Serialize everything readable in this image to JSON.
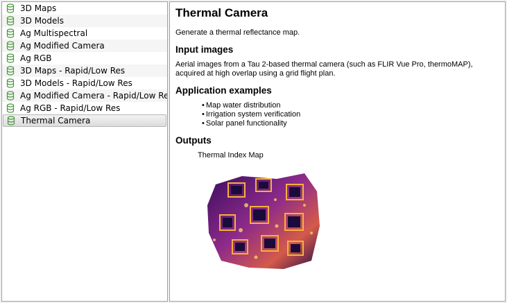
{
  "templates": [
    {
      "label": "3D Maps"
    },
    {
      "label": "3D Models"
    },
    {
      "label": "Ag Multispectral"
    },
    {
      "label": "Ag Modified Camera"
    },
    {
      "label": "Ag RGB"
    },
    {
      "label": "3D Maps - Rapid/Low Res"
    },
    {
      "label": "3D Models - Rapid/Low Res"
    },
    {
      "label": "Ag Modified Camera - Rapid/Low Res"
    },
    {
      "label": "Ag RGB - Rapid/Low Res"
    },
    {
      "label": "Thermal Camera"
    }
  ],
  "selected_index": 9,
  "detail": {
    "title": "Thermal Camera",
    "description": "Generate a thermal reflectance map.",
    "input_heading": "Input images",
    "input_text": "Aerial images from a Tau 2-based thermal camera (such as FLIR Vue Pro, thermoMAP), acquired at high overlap using a grid flight plan.",
    "examples_heading": "Application examples",
    "examples": [
      "Map water distribution",
      "Irrigation system verification",
      "Solar panel functionality"
    ],
    "outputs_heading": "Outputs",
    "output_caption": "Thermal Index Map"
  },
  "colors": {
    "icon_green": "#4a9a3c",
    "thermal_dark": "#1a0b3a",
    "thermal_mid": "#9b2f8f",
    "thermal_hot": "#f4b23a"
  }
}
